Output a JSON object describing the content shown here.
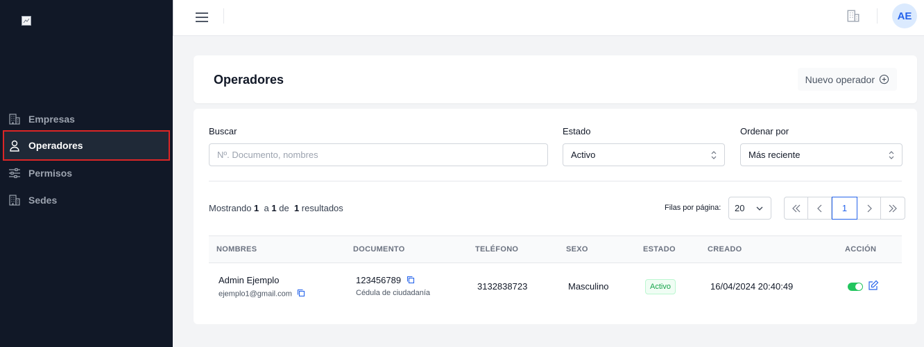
{
  "sidebar": {
    "items": [
      {
        "label": "Empresas",
        "icon": "building-icon"
      },
      {
        "label": "Operadores",
        "icon": "user-icon",
        "active": true
      },
      {
        "label": "Permisos",
        "icon": "sliders-icon"
      },
      {
        "label": "Sedes",
        "icon": "building-icon"
      }
    ]
  },
  "topbar": {
    "avatar_initials": "AE"
  },
  "header": {
    "title": "Operadores",
    "new_button_label": "Nuevo operador"
  },
  "filters": {
    "search_label": "Buscar",
    "search_placeholder": "Nº. Documento, nombres",
    "status_label": "Estado",
    "status_value": "Activo",
    "order_label": "Ordenar por",
    "order_value": "Más reciente"
  },
  "results": {
    "prefix": "Mostrando",
    "from": "1",
    "to_word": "a",
    "to": "1",
    "of_word": "de",
    "total": "1",
    "suffix": "resultados",
    "rows_per_page_label": "Filas por página:",
    "rows_per_page": "20",
    "current_page": "1"
  },
  "table": {
    "columns": [
      "NOMBRES",
      "DOCUMENTO",
      "TELÉFONO",
      "SEXO",
      "ESTADO",
      "CREADO",
      "ACCIÓN"
    ],
    "rows": [
      {
        "name": "Admin Ejemplo",
        "email": "ejemplo1@gmail.com",
        "document": "123456789",
        "document_type": "Cédula de ciudadanía",
        "phone": "3132838723",
        "sex": "Masculino",
        "status": "Activo",
        "created": "16/04/2024 20:40:49"
      }
    ]
  },
  "colors": {
    "sidebar_bg": "#111827",
    "accent": "#2563eb",
    "active_outline": "#dc2626",
    "status_green": "#16a34a"
  }
}
